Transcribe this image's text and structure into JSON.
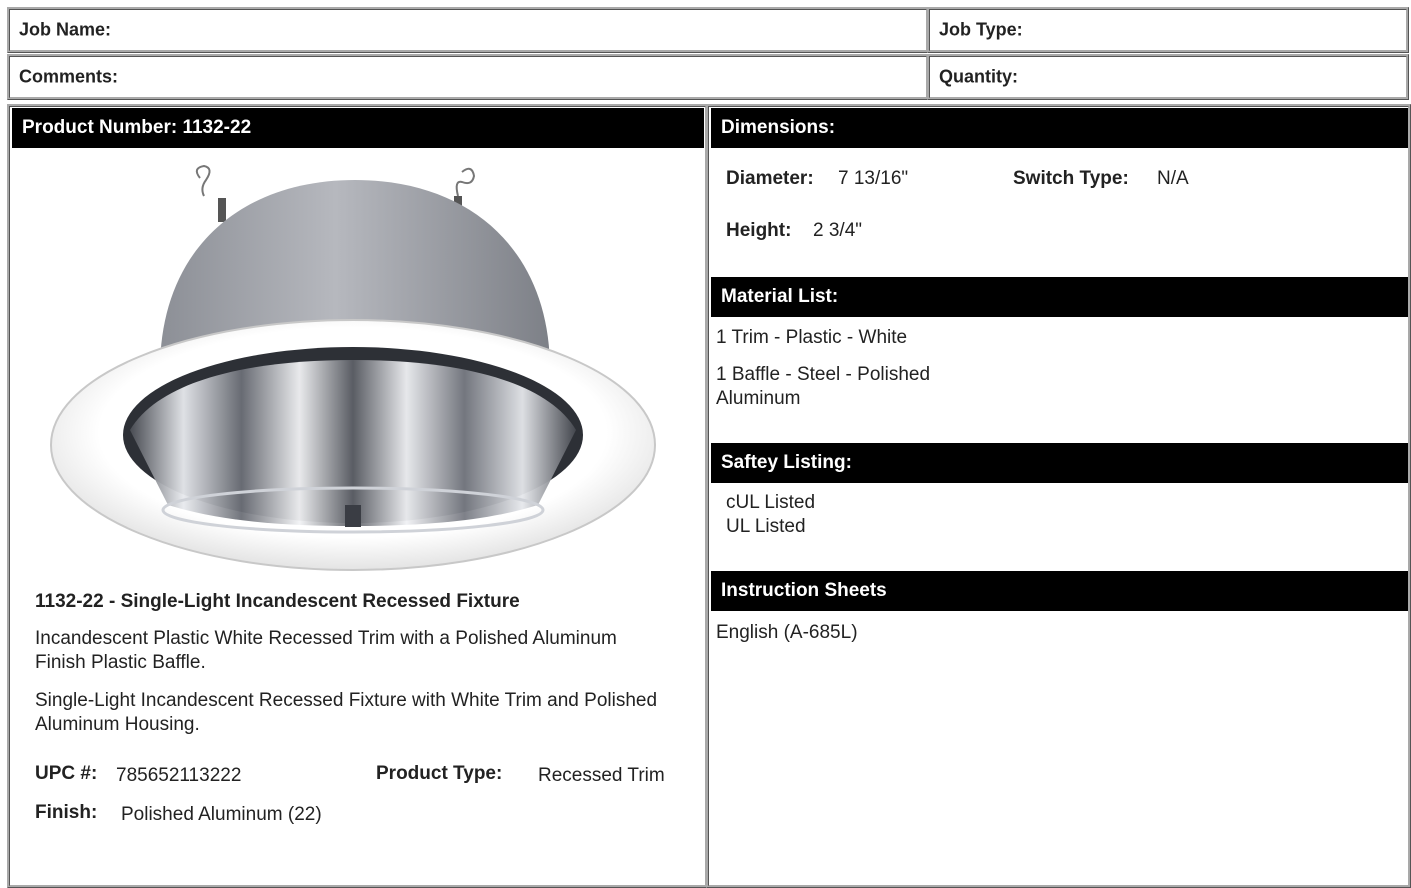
{
  "header": {
    "job_name_label": "Job Name:",
    "job_type_label": "Job Type:",
    "comments_label": "Comments:",
    "quantity_label": "Quantity:"
  },
  "product": {
    "number_bar": "Product Number: 1132-22",
    "title": "1132-22 - Single-Light Incandescent Recessed Fixture",
    "description_1": "Incandescent Plastic White Recessed Trim with a Polished Aluminum Finish Plastic Baffle.",
    "description_2": "Single-Light Incandescent Recessed Fixture with White Trim and Polished Aluminum Housing.",
    "upc_label": "UPC #:",
    "upc_value": "785652113222",
    "type_label": "Product Type:",
    "type_value": "Recessed Trim",
    "finish_label": "Finish:",
    "finish_value": "Polished Aluminum (22)"
  },
  "dimensions": {
    "bar": "Dimensions:",
    "diameter_label": "Diameter:",
    "diameter_value": "7 13/16\"",
    "switch_label": "Switch Type:",
    "switch_value": "N/A",
    "height_label": "Height:",
    "height_value": "2 3/4\""
  },
  "materials": {
    "bar": "Material List:",
    "item_1": "1 Trim - Plastic - White",
    "item_2_line1": "1 Baffle - Steel - Polished",
    "item_2_line2": "Aluminum"
  },
  "safety": {
    "bar": "Saftey Listing:",
    "item_1": "cUL Listed",
    "item_2": "UL Listed"
  },
  "instructions": {
    "bar": "Instruction Sheets",
    "link": "English (A-685L)"
  }
}
